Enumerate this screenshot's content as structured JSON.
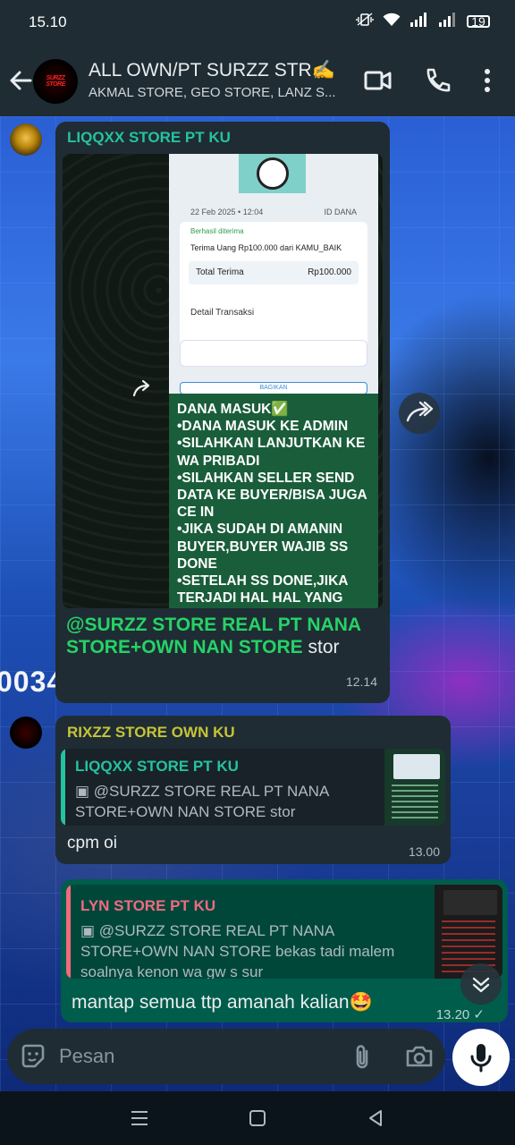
{
  "status": {
    "time": "15.10",
    "battery": "19"
  },
  "header": {
    "title": "ALL OWN/PT SURZZ STR✍️",
    "subtitle": "AKMAL STORE, GEO STORE, LANZ S...",
    "avatar_text": "SURZZ STORE"
  },
  "wallpaper": {
    "number": "0034"
  },
  "messages": {
    "m1": {
      "sender": "LIQQXX STORE PT KU",
      "sender_color": "#25c2a0",
      "receipt": {
        "date": "22 Feb 2025 • 12:04",
        "brand": "ID DANA",
        "status": "Berhasil diterima",
        "received": "Terima Uang Rp100.000 dari KAMU_BAIK",
        "total_label": "Total Terima",
        "total_value": "Rp100.000",
        "detail": "Detail Transaksi",
        "share": "BAGIKAN"
      },
      "caption": "DANA MASUK✅\n•DANA MASUK KE ADMIN\n•SILAHKAN LANJUTKAN KE WA PRIBADI\n•SILAHKAN SELLER SEND DATA KE BUYER/BISA JUGA CE IN\n•JIKA SUDAH DI AMANIN BUYER,BUYER WAJIB SS DONE\n•SETELAH SS DONE,JIKA TERJADI HAL HAL YANG",
      "mention": "@SURZZ STORE REAL PT NANA STORE+OWN NAN STORE",
      "text": " stor",
      "time": "12.14"
    },
    "m2": {
      "sender": "RIXZZ STORE OWN KU",
      "sender_color": "#c7c437",
      "quote_name": "LIQQXX STORE PT KU",
      "quote_color": "#25c2a0",
      "quote_text": "@SURZZ STORE REAL PT NANA STORE+OWN NAN STORE stor",
      "text": "cpm oi",
      "time": "13.00"
    },
    "m3": {
      "quote_name": "LYN STORE PT KU",
      "quote_color": "#f06a80",
      "quote_text": "@SURZZ STORE REAL PT NANA STORE+OWN NAN STORE bekas tadi malem soalnya kenon wa gw s sur",
      "text": "mantap semua ttp amanah kalian🤩",
      "time": "13.20 ✓"
    }
  },
  "input": {
    "placeholder": "Pesan"
  },
  "colors": {
    "header": "#1f2c34",
    "incoming": "#1f2c34",
    "outgoing": "#005c4b",
    "accent": "#25d366"
  }
}
